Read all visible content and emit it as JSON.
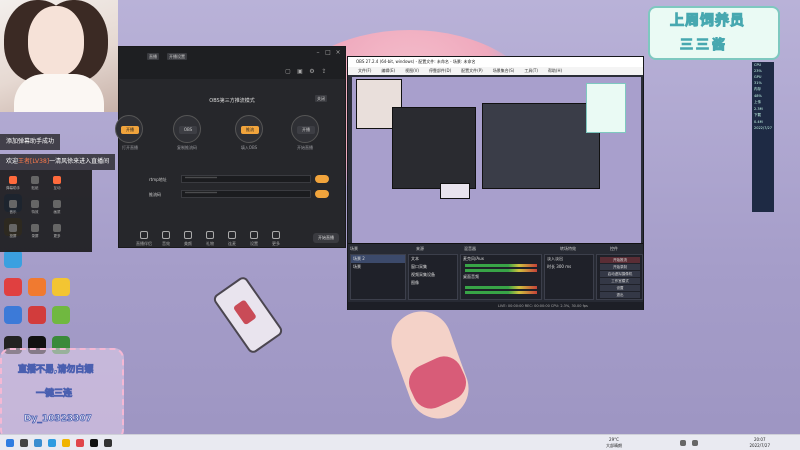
{
  "toasts": {
    "toast_1": "添加弹幕助手成功",
    "toast_2_prefix": "欢迎",
    "toast_2_user": "王者",
    "toast_2_level": "[LV38]",
    "toast_2_suffix": "一清风徐来进入直播间"
  },
  "live_app": {
    "header_tags": [
      "直播",
      "开播设置"
    ],
    "title": "OBS第三方推流模式",
    "top_action": "关闭",
    "steps": [
      "开播",
      "OBS",
      "推流",
      "开播"
    ],
    "step_labels": [
      "打开直播",
      "复制推流码",
      "填入OBS",
      "开始直播"
    ],
    "rtmp_label": "rtmp地址",
    "rtmp_value": "****************",
    "key_label": "推流码",
    "key_value": "****************",
    "tools": [
      "直播伴侣",
      "音效",
      "美颜",
      "礼物",
      "连麦",
      "设置",
      "更多"
    ],
    "go_live": "开始直播"
  },
  "left_tools": [
    "弹幕助手",
    "贴纸",
    "互动",
    "音乐",
    "特效",
    "画质",
    "投屏",
    "录屏",
    "更多"
  ],
  "obs": {
    "title": "OBS 27.2.4 (64-bit, windows) - 配置文件: 未命名 - 场景: 未命名",
    "menu": [
      "文件(F)",
      "编辑(E)",
      "视图(V)",
      "停靠部件(D)",
      "配置文件(P)",
      "场景集合(S)",
      "工具(T)",
      "帮助(H)"
    ],
    "dock_heads": [
      "场景",
      "来源",
      "混音器",
      "转场特效",
      "控件"
    ],
    "scenes": [
      "场景 2",
      "场景"
    ],
    "sources": [
      "文本",
      "窗口采集",
      "视频采集设备",
      "图像"
    ],
    "mixer": [
      "麦克风/Aux",
      "桌面音频"
    ],
    "transition": "淡入淡出",
    "duration_label": "时长",
    "duration": "300 ms",
    "controls": [
      "开始推流",
      "开始录制",
      "启动虚拟摄像机",
      "工作室模式",
      "设置",
      "退出"
    ],
    "status": "LIVE: 00:00:00  REC: 00:00:00  CPU: 2.3%, 30.00 fps"
  },
  "title_card": {
    "line1": "上周饲养员",
    "line2": "三三酱"
  },
  "monitor": [
    "CPU",
    "23%",
    "GPU",
    "31%",
    "内存",
    "48%",
    "上传",
    "2.3M",
    "下载",
    "0.4M",
    "2022/7/27"
  ],
  "caption": {
    "line1": "直播不易,请勿白嫖",
    "line2": "一键三连",
    "line3": "Dy_10323307"
  },
  "taskbar": {
    "temp": "29°C",
    "weather": "大部晴朗",
    "time": "20:07",
    "date": "2022/7/27"
  },
  "colors": {
    "accent_orange": "#f1a43c",
    "obs_bg": "#2b2e38",
    "wallpaper": "#b9b2d8"
  }
}
